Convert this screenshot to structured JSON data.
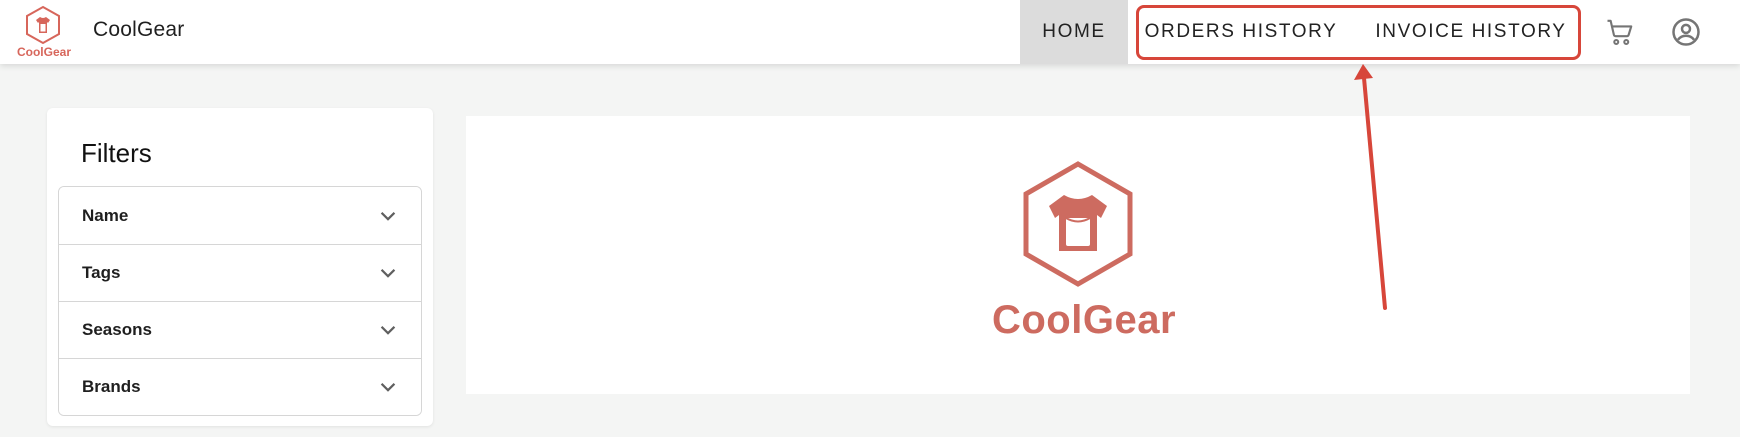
{
  "app": {
    "brand_name": "CoolGear",
    "logo_caption": "CoolGear",
    "brand_color": "#d7665b"
  },
  "nav": {
    "home": "HOME",
    "orders_history": "ORDERS HISTORY",
    "invoice_history": "INVOICE HISTORY",
    "active": "HOME"
  },
  "icons": {
    "cart": "shopping-cart-icon",
    "account": "account-circle-icon"
  },
  "annotation": {
    "highlight_color": "#d7463a",
    "target": "ORDERS HISTORY / INVOICE HISTORY"
  },
  "filters": {
    "title": "Filters",
    "items": [
      {
        "label": "Name"
      },
      {
        "label": "Tags"
      },
      {
        "label": "Seasons"
      },
      {
        "label": "Brands"
      }
    ]
  },
  "banner": {
    "wordmark": "CoolGear"
  }
}
